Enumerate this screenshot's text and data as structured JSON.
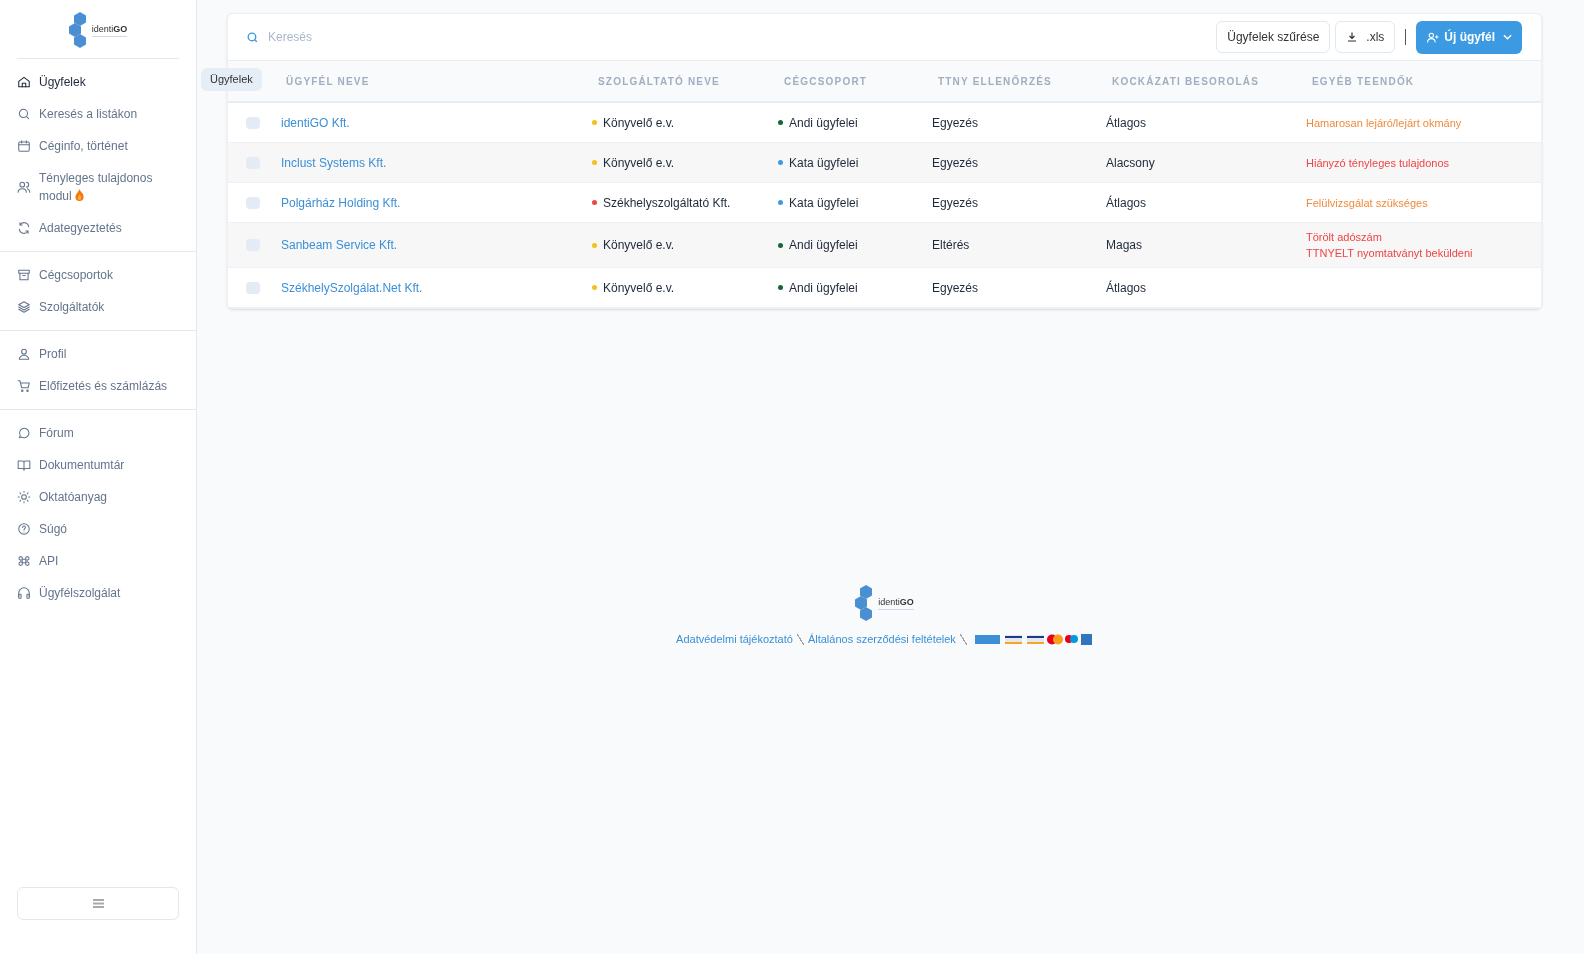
{
  "logo": {
    "text": "identi**GO**"
  },
  "sidebar": {
    "groups": [
      {
        "items": [
          {
            "label": "Ügyfelek",
            "selected": true
          },
          {
            "label": "Keresés a listákon",
            "selected": false
          },
          {
            "label": "Céginfo, történet",
            "selected": false
          },
          {
            "label": "Tényleges tulajdonos modul",
            "selected": false,
            "hot": true
          },
          {
            "label": "Adategyeztetés",
            "selected": false
          }
        ]
      },
      {
        "items": [
          {
            "label": "Cégcsoportok",
            "selected": false
          },
          {
            "label": "Szolgáltatók",
            "selected": false
          }
        ]
      },
      {
        "items": [
          {
            "label": "Profil",
            "selected": false
          },
          {
            "label": "Előfizetés és számlázás",
            "selected": false
          }
        ]
      },
      {
        "items": [
          {
            "label": "Fórum",
            "selected": false
          },
          {
            "label": "Dokumentumtár",
            "selected": false
          },
          {
            "label": "Oktatóanyag",
            "selected": false
          },
          {
            "label": "Súgó",
            "selected": false
          },
          {
            "label": "API",
            "selected": false
          },
          {
            "label": "Ügyfélszolgálat",
            "selected": false
          }
        ]
      }
    ]
  },
  "tooltip": "Ügyfelek",
  "toolbar": {
    "search": {
      "placeholder": "Keresés"
    },
    "filter_button": "Ügyfelek szűrése",
    "export_button": ".xls",
    "new_button": "Új ügyfél"
  },
  "table": {
    "columns": [
      "ÜGYFÉL NEVE",
      "SZOLGÁLTATÓ NEVE",
      "CÉGCSOPORT",
      "TTNY ELLENŐRZÉS",
      "KOCKÁZATI BESOROLÁS",
      "EGYÉB TEENDŐK"
    ],
    "rows": [
      {
        "checked": false,
        "name": "identiGO Kft.",
        "provider": {
          "text": "Könyvelő e.v.",
          "color": "#f5c116"
        },
        "group": {
          "text": "Andi ügyfelei",
          "color": "#166534"
        },
        "ttny": "Egyezés",
        "risk": "Átlagos",
        "todos": [
          {
            "text": "Hamarosan lejáró/lejárt okmány",
            "color": "#f08a3c"
          }
        ]
      },
      {
        "checked": false,
        "name": "Inclust Systems Kft.",
        "provider": {
          "text": "Könyvelő e.v.",
          "color": "#f5c116"
        },
        "group": {
          "text": "Kata ügyfelei",
          "color": "#3b9ae1"
        },
        "ttny": "Egyezés",
        "risk": "Alacsony",
        "todos": [
          {
            "text": "Hiányzó tényleges tulajdonos",
            "color": "#ef4444"
          }
        ]
      },
      {
        "checked": false,
        "name": "Polgárház Holding Kft.",
        "provider": {
          "text": "Székhelyszolgáltató Kft.",
          "color": "#ef4444"
        },
        "group": {
          "text": "Kata ügyfelei",
          "color": "#3b9ae1"
        },
        "ttny": "Egyezés",
        "risk": "Átlagos",
        "todos": [
          {
            "text": "Felülvizsgálat szükséges",
            "color": "#f08a3c"
          }
        ]
      },
      {
        "checked": false,
        "name": "Sanbeam Service Kft.",
        "provider": {
          "text": "Könyvelő e.v.",
          "color": "#f5c116"
        },
        "group": {
          "text": "Andi ügyfelei",
          "color": "#166534"
        },
        "ttny": "Eltérés",
        "risk": "Magas",
        "todos": [
          {
            "text": "Törölt adószám",
            "color": "#ef4444"
          },
          {
            "text": "TTNYELT nyomtatványt beküldeni",
            "color": "#ef4444"
          }
        ]
      },
      {
        "checked": false,
        "name": "SzékhelySzolgálat.Net Kft.",
        "provider": {
          "text": "Könyvelő e.v.",
          "color": "#f5c116"
        },
        "group": {
          "text": "Andi ügyfelei",
          "color": "#166534"
        },
        "ttny": "Egyezés",
        "risk": "Átlagos"
      }
    ]
  },
  "footer": {
    "logo_text": "identi**GO**",
    "links": [
      "Adatvédelmi tájékoztató",
      "Általános szerződési feltételek"
    ]
  }
}
